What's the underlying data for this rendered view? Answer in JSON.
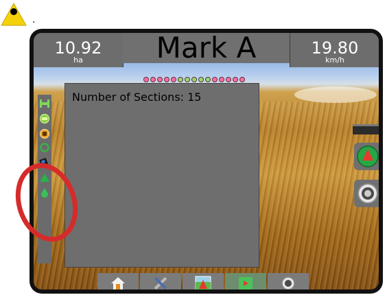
{
  "annotation": {
    "warning_icon": "warning-triangle-icon",
    "trailing_dot": "."
  },
  "header": {
    "area_value": "10.92",
    "area_unit": "ha",
    "title": "Mark A",
    "speed_value": "19.80",
    "speed_unit": "km/h"
  },
  "lightbar": {
    "leds": [
      "#ff6fa3",
      "#ff6fa3",
      "#ff6fa3",
      "#ff6fa3",
      "#ff6fa3",
      "#9ad86e",
      "#9ad86e",
      "#9ad86e",
      "#9ad86e",
      "#9ad86e",
      "#ff6fa3",
      "#ff6fa3",
      "#ff6fa3",
      "#ff6fa3",
      "#ff6fa3"
    ]
  },
  "panel": {
    "text": "Number of Sections: 15"
  },
  "sidebar": {
    "icons": [
      "boom-h-icon",
      "boom-status-icon",
      "section-target-icon",
      "circle-status-icon",
      "coverage-device-icon",
      "guidance-triangle-icon",
      "droplet-icon"
    ]
  },
  "right_buttons": [
    "navigation-arrow-icon",
    "gauge-icon"
  ],
  "bottom_nav": {
    "tabs": [
      "home-icon",
      "tools-icon",
      "field-view-icon",
      "marker-flag-icon",
      "settings-dial-icon"
    ],
    "active_index": 3
  },
  "colors": {
    "panel_grey": "#6e6e6e",
    "highlight_green": "#6c8e6d",
    "annotation_red": "#d62b2b",
    "warning_yellow": "#f5d10a"
  }
}
